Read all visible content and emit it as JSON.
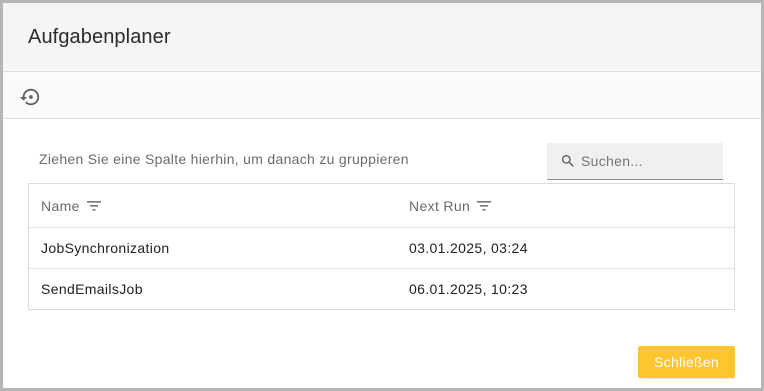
{
  "dialog": {
    "title": "Aufgabenplaner"
  },
  "toolbar": {
    "history_icon": "restore-history-icon"
  },
  "grid": {
    "group_panel_text": "Ziehen Sie eine Spalte hierhin, um danach zu gruppieren",
    "search": {
      "placeholder": "Suchen...",
      "value": ""
    },
    "columns": [
      {
        "label": "Name",
        "icon": "filter-icon"
      },
      {
        "label": "Next Run",
        "icon": "filter-icon"
      }
    ],
    "rows": [
      {
        "name": "JobSynchronization",
        "next_run": "03.01.2025, 03:24"
      },
      {
        "name": "SendEmailsJob",
        "next_run": "06.01.2025, 10:23"
      }
    ]
  },
  "footer": {
    "close_label": "Schließen"
  },
  "colors": {
    "accent": "#ffc52e",
    "header_bg": "#f5f5f5",
    "border": "#b5b5b5"
  }
}
